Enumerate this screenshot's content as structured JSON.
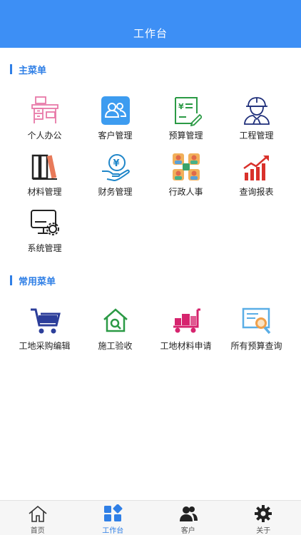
{
  "header": {
    "title": "工作台"
  },
  "main_menu": {
    "title": "主菜单",
    "items": [
      {
        "label": "个人办公",
        "icon": "office-desk-icon"
      },
      {
        "label": "客户管理",
        "icon": "customers-icon"
      },
      {
        "label": "预算管理",
        "icon": "budget-icon"
      },
      {
        "label": "工程管理",
        "icon": "engineer-icon"
      },
      {
        "label": "材料管理",
        "icon": "materials-icon"
      },
      {
        "label": "财务管理",
        "icon": "finance-icon"
      },
      {
        "label": "行政人事",
        "icon": "hr-icon"
      },
      {
        "label": "查询报表",
        "icon": "report-chart-icon"
      },
      {
        "label": "系统管理",
        "icon": "system-settings-icon"
      }
    ]
  },
  "common_menu": {
    "title": "常用菜单",
    "items": [
      {
        "label": "工地采购编辑",
        "icon": "shopping-cart-icon"
      },
      {
        "label": "施工验收",
        "icon": "house-inspect-icon"
      },
      {
        "label": "工地材料申请",
        "icon": "material-cart-icon"
      },
      {
        "label": "所有预算查询",
        "icon": "budget-search-icon"
      }
    ]
  },
  "tabbar": {
    "items": [
      {
        "label": "首页",
        "icon": "home-icon",
        "active": false
      },
      {
        "label": "工作台",
        "icon": "workbench-icon",
        "active": true
      },
      {
        "label": "客户",
        "icon": "customers-icon",
        "active": false
      },
      {
        "label": "关于",
        "icon": "gear-icon",
        "active": false
      }
    ]
  },
  "colors": {
    "primary": "#3d8ff5",
    "accent": "#2f7fe6",
    "tab_bg": "#f6f6f6"
  }
}
